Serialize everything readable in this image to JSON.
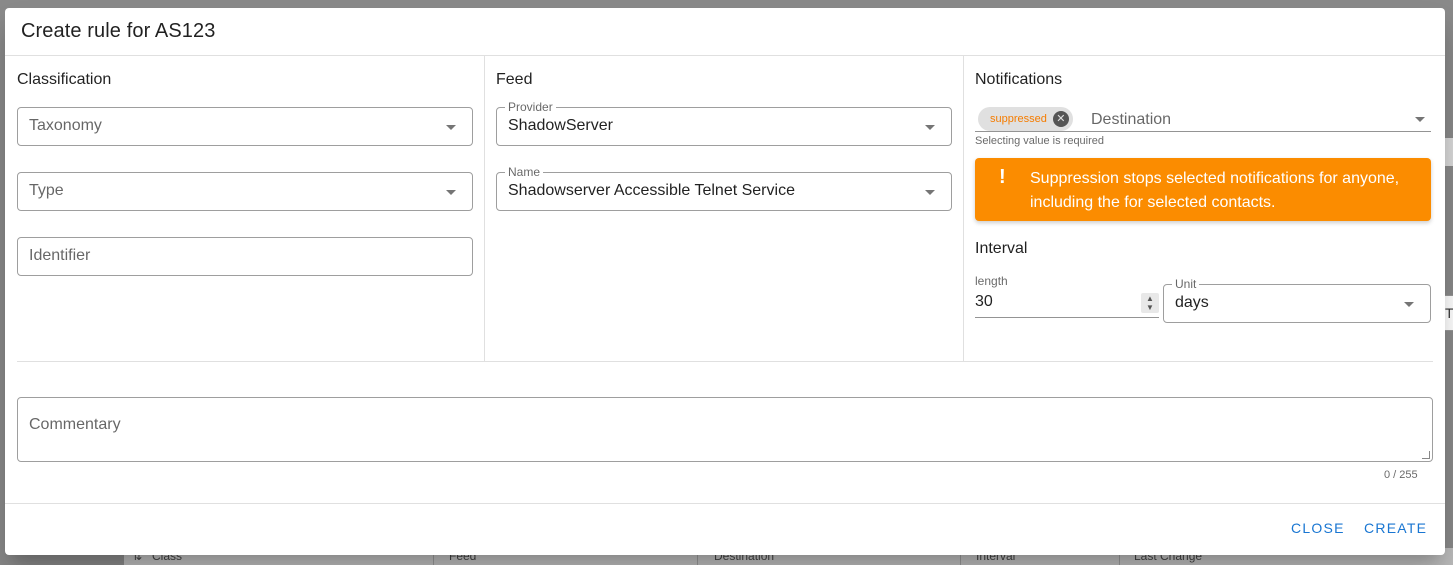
{
  "dialog": {
    "title": "Create rule for AS123"
  },
  "classification": {
    "title": "Classification",
    "taxonomy_placeholder": "Taxonomy",
    "type_placeholder": "Type",
    "identifier_placeholder": "Identifier"
  },
  "feed": {
    "title": "Feed",
    "provider_label": "Provider",
    "provider_value": "ShadowServer",
    "name_label": "Name",
    "name_value": "Shadowserver Accessible Telnet Service"
  },
  "notifications": {
    "title": "Notifications",
    "chip_label": "suppressed",
    "destination_placeholder": "Destination",
    "hint": "Selecting value is required",
    "alert_icon": "!",
    "alert_text": "Suppression stops selected notifications for anyone, including the for selected contacts."
  },
  "interval": {
    "title": "Interval",
    "length_label": "length",
    "length_value": "30",
    "unit_label": "Unit",
    "unit_value": "days"
  },
  "commentary": {
    "placeholder": "Commentary",
    "counter": "0 / 255"
  },
  "actions": {
    "close": "CLOSE",
    "create": "CREATE"
  },
  "background": {
    "columns": [
      "Class",
      "Feed",
      "Destination",
      "Interval",
      "Last Change"
    ]
  },
  "colors": {
    "accent": "#1976d2",
    "warning": "#fb8c00",
    "chip_text": "#f57c00"
  }
}
